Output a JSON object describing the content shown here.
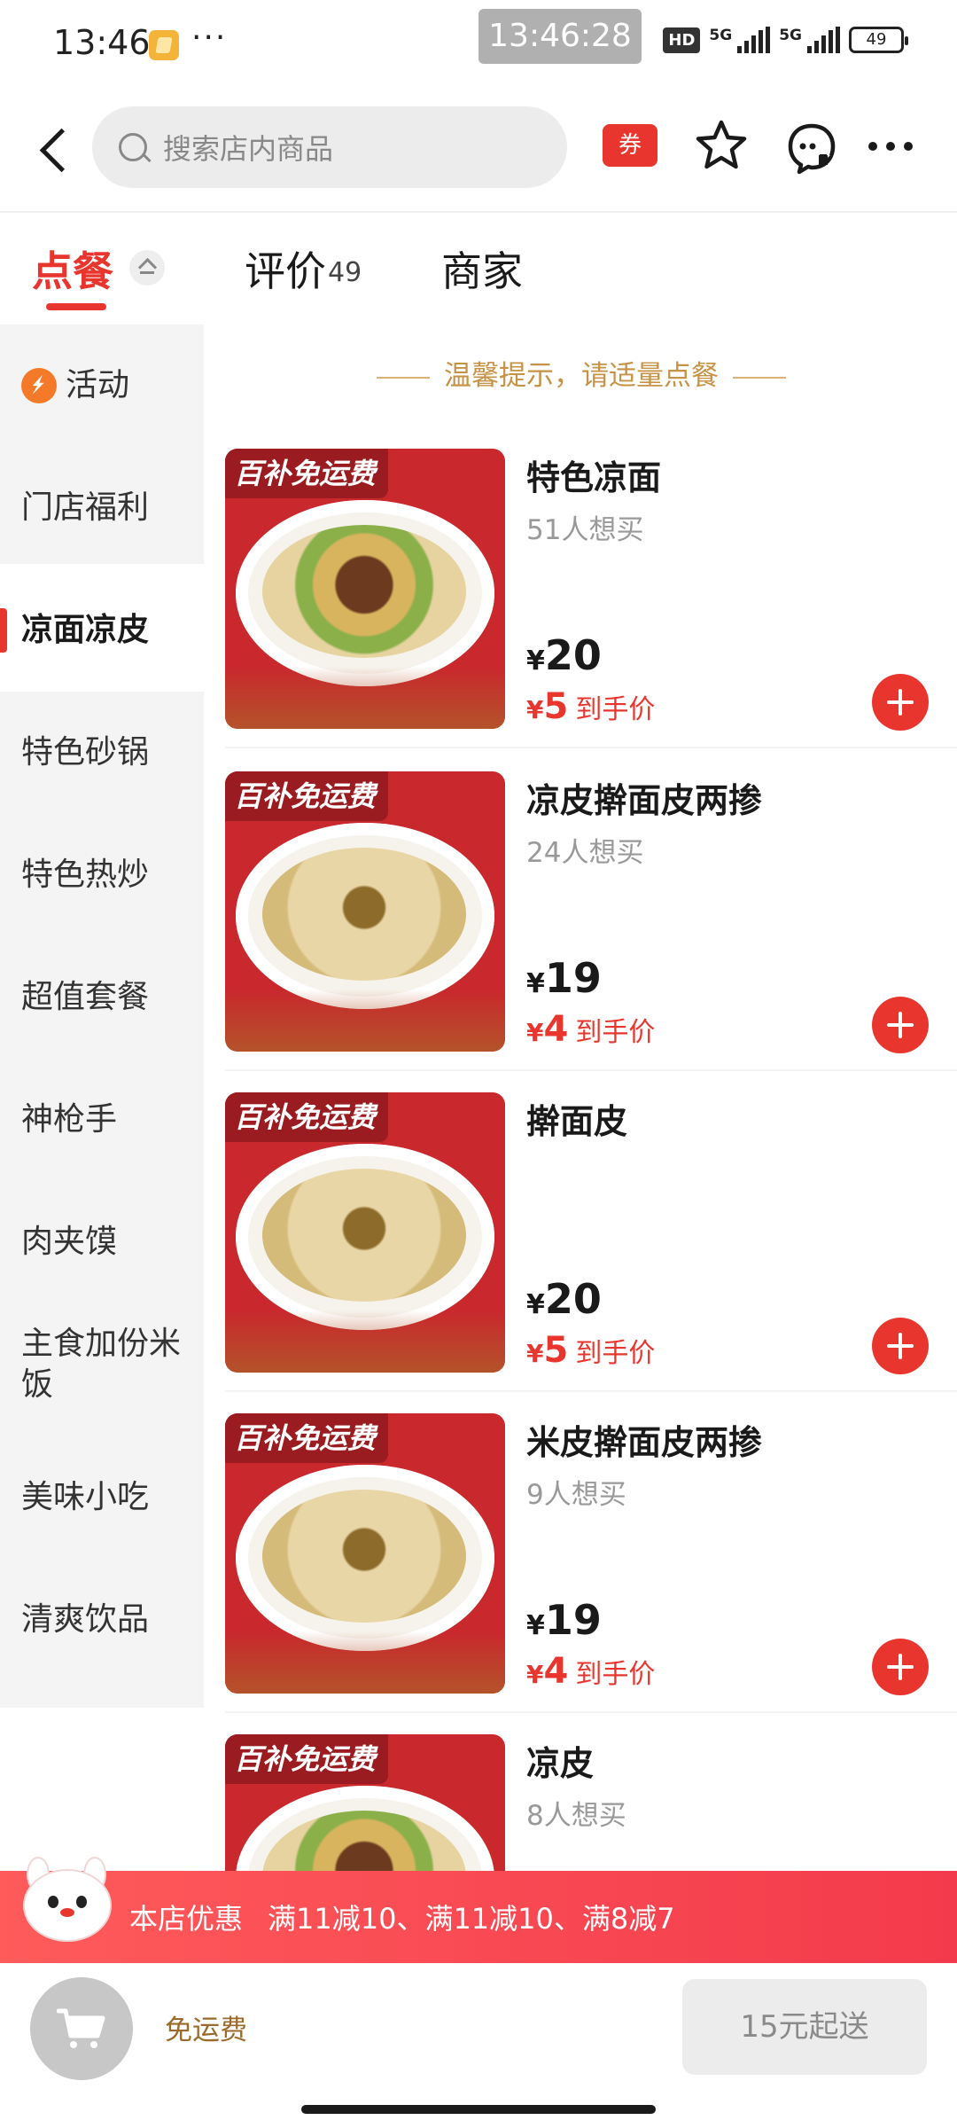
{
  "status_bar": {
    "time": "13:46",
    "more": "···",
    "clock_pill": "13:46:28",
    "hd": "HD",
    "net1": "5G",
    "net2": "5G",
    "battery": "49"
  },
  "header": {
    "search_placeholder": "搜索店内商品",
    "coupon_label": "券"
  },
  "tabs": {
    "order": "点餐",
    "reviews": "评价",
    "reviews_count": "49",
    "merchant": "商家"
  },
  "sidebar": {
    "items": [
      {
        "label": "活动"
      },
      {
        "label": "门店福利"
      },
      {
        "label": "凉面凉皮"
      },
      {
        "label": "特色砂锅"
      },
      {
        "label": "特色热炒"
      },
      {
        "label": "超值套餐"
      },
      {
        "label": "神枪手"
      },
      {
        "label": "肉夹馍"
      },
      {
        "label": "主食加份米饭"
      },
      {
        "label": "美味小吃"
      },
      {
        "label": "清爽饮品"
      }
    ]
  },
  "tip": "温馨提示，请适量点餐",
  "products": [
    {
      "badge": "百补免运费",
      "name": "特色凉面",
      "wants": "51人想买",
      "price": "20",
      "final_price": "5",
      "final_label": "到手价"
    },
    {
      "badge": "百补免运费",
      "name": "凉皮擀面皮两掺",
      "wants": "24人想买",
      "price": "19",
      "final_price": "4",
      "final_label": "到手价"
    },
    {
      "badge": "百补免运费",
      "name": "擀面皮",
      "wants": "",
      "price": "20",
      "final_price": "5",
      "final_label": "到手价"
    },
    {
      "badge": "百补免运费",
      "name": "米皮擀面皮两掺",
      "wants": "9人想买",
      "price": "19",
      "final_price": "4",
      "final_label": "到手价"
    },
    {
      "badge": "百补免运费",
      "name": "凉皮",
      "wants": "8人想买"
    }
  ],
  "currency": "¥",
  "promo": {
    "label": "本店优惠",
    "text": "满11减10、满11减10、满8减7"
  },
  "bottom_bar": {
    "shipping": "免运费",
    "min_order": "15元起送"
  },
  "colors": {
    "accent": "#e8362f",
    "tip": "#c69246",
    "sidebar_bg": "#f4f4f4"
  }
}
